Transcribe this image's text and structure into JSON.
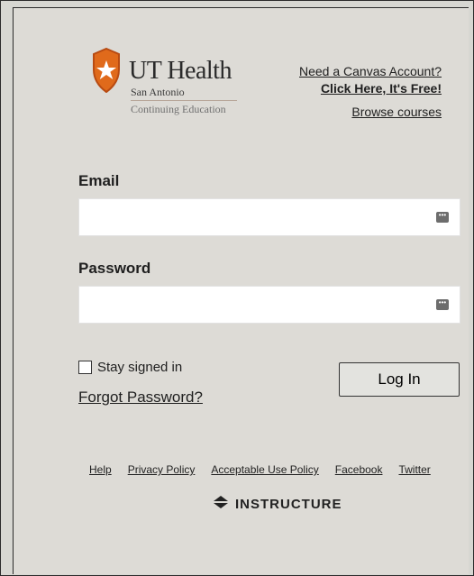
{
  "logo": {
    "main": "UT Health",
    "location": "San Antonio",
    "department": "Continuing Education"
  },
  "top_links": {
    "need_account": "Need a Canvas Account?",
    "click_here": "Click Here, It's Free!",
    "browse": "Browse courses"
  },
  "form": {
    "email_label": "Email",
    "email_value": "",
    "password_label": "Password",
    "password_value": "",
    "stay_signed_in_label": "Stay signed in",
    "stay_signed_in_checked": false,
    "forgot_password": "Forgot Password?",
    "login_button": "Log In"
  },
  "footer": {
    "links": [
      "Help",
      "Privacy Policy",
      "Acceptable Use Policy",
      "Facebook",
      "Twitter"
    ],
    "brand": "INSTRUCTURE"
  },
  "colors": {
    "background": "#dddbd6",
    "accent": "#e06a1b"
  }
}
